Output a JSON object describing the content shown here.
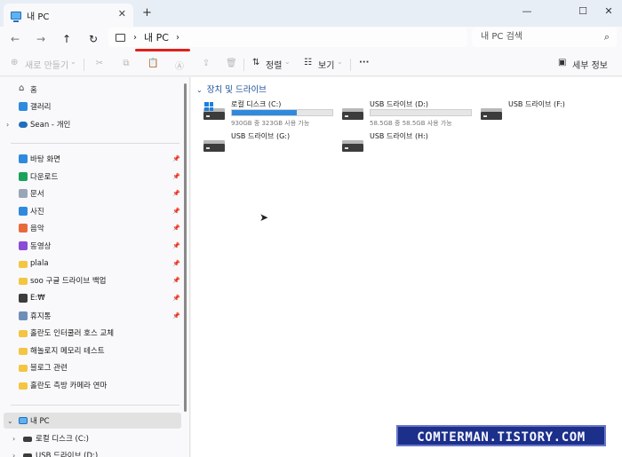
{
  "window": {
    "tab_title": "내 PC",
    "tab_close": "✕",
    "new_tab": "+",
    "minimize": "—",
    "maximize": "☐",
    "close": "✕"
  },
  "address": {
    "back": "←",
    "forward": "→",
    "up": "↑",
    "refresh": "↻",
    "separator1": "›",
    "crumb": "내 PC",
    "separator2": "›",
    "search_placeholder": "내 PC 검색",
    "search_icon": "⌕"
  },
  "toolbar": {
    "new_label": "새로 만들기",
    "new_icon": "⊕",
    "dropdown": "⌄",
    "sort_label": "정렬",
    "sort_icon": "⇅",
    "view_label": "보기",
    "view_icon": "☷",
    "more_label": "···",
    "details_label": "세부 정보",
    "details_icon": "▣"
  },
  "sidebar": {
    "home": "홈",
    "gallery": "갤러리",
    "onedrive": "Sean - 개인",
    "quick": [
      "바탕 화면",
      "다운로드",
      "문서",
      "사진",
      "음악",
      "동영상",
      "plala",
      "soo 구글 드라이브 백업",
      "E:₩",
      "휴지통",
      "홀란도 인터쿨러 호스 교체",
      "해놀로지 메모리 테스트",
      "블로그 관련",
      "홀란도 측방 카메라 연마"
    ],
    "pin_icon": "📌",
    "this_pc": "내 PC",
    "local_disk": "로컬 디스크 (C:)",
    "usb_d": "USB 드라이브 (D:)",
    "chevron_right": "›",
    "chevron_down": "⌄"
  },
  "main": {
    "group_title": "장치 및 드라이브",
    "drives": [
      {
        "name": "로컬 디스크 (C:)",
        "size": "930GB 중 323GB 사용 가능",
        "used_fraction": 0.65,
        "windows": true
      },
      {
        "name": "USB 드라이브 (D:)",
        "size": "58.5GB 중 58.5GB 사용 가능",
        "used_fraction": 0.0
      },
      {
        "name": "USB 드라이브 (F:)"
      },
      {
        "name": "USB 드라이브 (G:)"
      },
      {
        "name": "USB 드라이브 (H:)"
      }
    ]
  },
  "watermark": "COMTERMAN.TISTORY.COM",
  "colors": {
    "accent": "#1f6fbf",
    "usage_bar": "#2f8ade",
    "annotation_red": "#e0201b",
    "watermark_bg": "#1c2f8a"
  }
}
